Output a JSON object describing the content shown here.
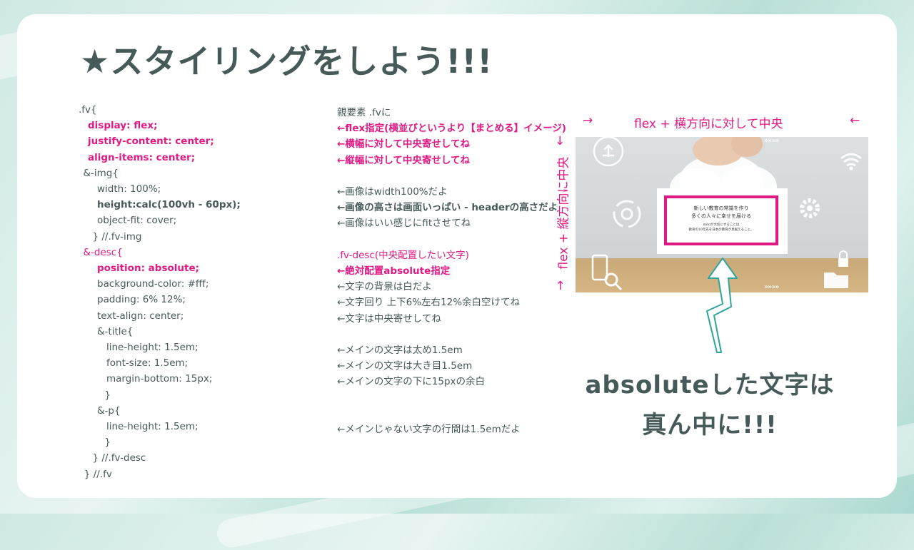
{
  "title": "★スタイリングをしよう!!!",
  "code_lines": [
    {
      "code": ".fv{",
      "note": "親要素 .fvに",
      "indent": 0,
      "code_style": "normal",
      "note_style": "normal"
    },
    {
      "code": "display: flex;",
      "note": "←flex指定(横並びというより【まとめる】イメージ)",
      "indent": 1,
      "code_style": "pink-bold",
      "note_style": "pink-bold"
    },
    {
      "code": "justify-content: center;",
      "note": "←横幅に対して中央寄せしてね",
      "indent": 1,
      "code_style": "pink-bold",
      "note_style": "pink-bold"
    },
    {
      "code": "align-items: center;",
      "note": "←縦幅に対して中央寄せしてね",
      "indent": 1,
      "code_style": "pink-bold",
      "note_style": "pink-bold"
    },
    {
      "code": "&-img{",
      "note": "",
      "indent": 0.5,
      "code_style": "normal",
      "note_style": "normal"
    },
    {
      "code": "width: 100%;",
      "note": "←画像はwidth100%だよ",
      "indent": 2,
      "code_style": "normal",
      "note_style": "normal"
    },
    {
      "code": "height:calc(100vh - 60px);",
      "note": "←画像の高さは画面いっぱい - headerの高さだよ",
      "indent": 2,
      "code_style": "bold",
      "note_style": "bold"
    },
    {
      "code": "object-fit: cover;",
      "note": "←画像はいい感じにfitさせてね",
      "indent": 2,
      "code_style": "normal",
      "note_style": "normal"
    },
    {
      "code": "} //.fv-img",
      "note": "",
      "indent": 1.5,
      "code_style": "normal",
      "note_style": "normal"
    },
    {
      "code": "&-desc{",
      "note": ".fv-desc(中央配置したい文字)",
      "indent": 0.5,
      "code_style": "pink",
      "note_style": "pink"
    },
    {
      "code": "position: absolute;",
      "note": "←絶対配置absolute指定",
      "indent": 2,
      "code_style": "pink-bold",
      "note_style": "pink-bold"
    },
    {
      "code": "background-color: #fff;",
      "note": "←文字の背景は白だよ",
      "indent": 2,
      "code_style": "normal",
      "note_style": "normal"
    },
    {
      "code": "padding: 6% 12%;",
      "note": "←文字回り 上下6%左右12%余白空けてね",
      "indent": 2,
      "code_style": "normal",
      "note_style": "normal"
    },
    {
      "code": "text-align: center;",
      "note": "←文字は中央寄せしてね",
      "indent": 2,
      "code_style": "normal",
      "note_style": "normal"
    },
    {
      "code": "&-title{",
      "note": "",
      "indent": 2,
      "code_style": "normal",
      "note_style": "normal"
    },
    {
      "code": "line-height: 1.5em;",
      "note": "←メインの文字は太め1.5em",
      "indent": 3,
      "code_style": "normal",
      "note_style": "normal"
    },
    {
      "code": "font-size: 1.5em;",
      "note": "←メインの文字は大き目1.5em",
      "indent": 3,
      "code_style": "normal",
      "note_style": "normal"
    },
    {
      "code": "margin-bottom: 15px;",
      "note": "←メインの文字の下に15pxの余白",
      "indent": 3,
      "code_style": "normal",
      "note_style": "normal"
    },
    {
      "code": "}",
      "note": "",
      "indent": 2.8,
      "code_style": "normal",
      "note_style": "normal"
    },
    {
      "code": "&-p{",
      "note": "",
      "indent": 2,
      "code_style": "normal",
      "note_style": "normal"
    },
    {
      "code": "line-height: 1.5em;",
      "note": "←メインじゃない文字の行間は1.5emだよ",
      "indent": 3,
      "code_style": "normal",
      "note_style": "normal"
    },
    {
      "code": "}",
      "note": "",
      "indent": 2.8,
      "code_style": "normal",
      "note_style": "normal"
    },
    {
      "code": "} //.fv-desc",
      "note": "",
      "indent": 1.5,
      "code_style": "normal",
      "note_style": "normal"
    },
    {
      "code": "} //.fv",
      "note": "",
      "indent": 0.6,
      "code_style": "normal",
      "note_style": "normal"
    }
  ],
  "figure": {
    "horizontal_label": "flex + 横方向に対して中央",
    "vertical_label": "flex + 縦方向に中央",
    "arrow_left": "→",
    "arrow_right": "←",
    "arrow_top": "↓",
    "arrow_bottom": "→",
    "desc_title_line1": "新しい教育の常識を作り",
    "desc_title_line2": "多くの人々に幸せを届ける",
    "desc_p_line1": "mitoが大切にすることは",
    "desc_p_line2": "教育の10年先を日本の教育が見据えること。",
    "chevrons": "»»»»"
  },
  "message": {
    "line1": "absoluteした文字は",
    "line2": "真ん中に!!!"
  },
  "colors": {
    "accent": "#e01a84",
    "text": "#465a59",
    "arrow": "#2fa59b"
  }
}
